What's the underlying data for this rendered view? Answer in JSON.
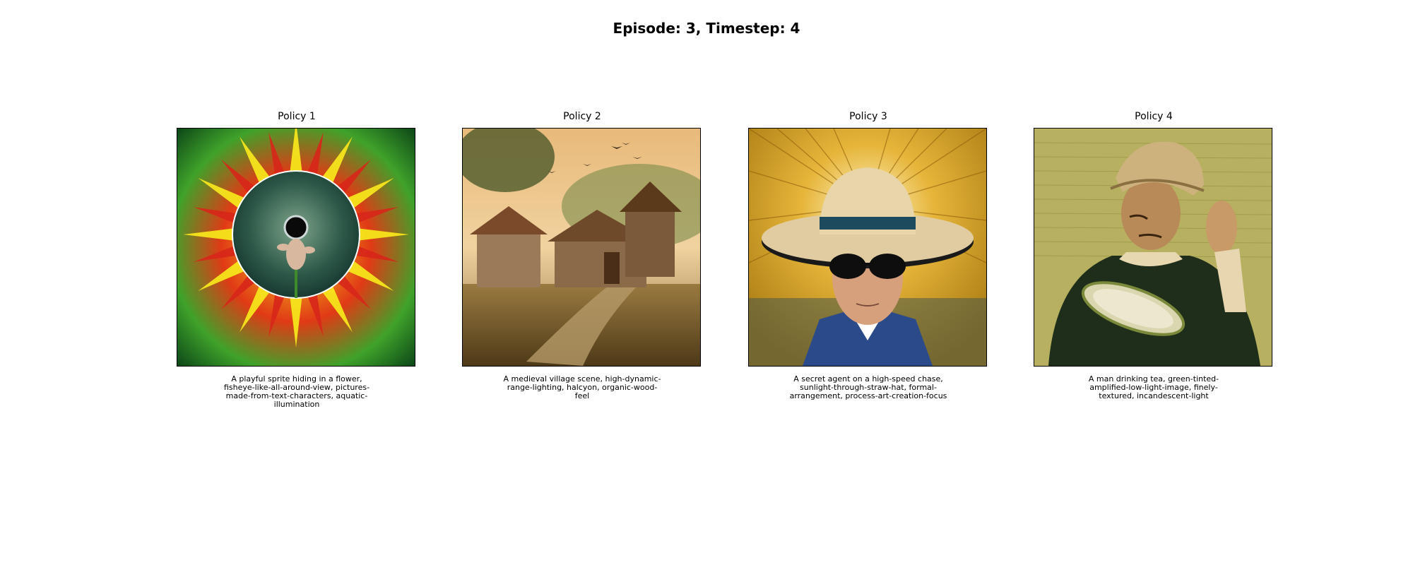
{
  "figure": {
    "title": "Episode: 3, Timestep: 4"
  },
  "panels": [
    {
      "title": "Policy 1",
      "caption": "A playful sprite hiding in a flower, fisheye-like-all-around-view, pictures-made-from-text-characters, aquatic-illumination",
      "image": "flower-with-fisheye-sprite"
    },
    {
      "title": "Policy 2",
      "caption": "A medieval village scene, high-dynamic-range-lighting, halcyon, organic-wood-feel",
      "image": "medieval-village"
    },
    {
      "title": "Policy 3",
      "caption": "A secret agent on a high-speed chase, sunlight-through-straw-hat, formal-arrangement, process-art-creation-focus",
      "image": "agent-in-straw-hat"
    },
    {
      "title": "Policy 4",
      "caption": "A man drinking tea, green-tinted-amplified-low-light-image, finely-textured, incandescent-light",
      "image": "man-with-tea-bowl"
    }
  ]
}
